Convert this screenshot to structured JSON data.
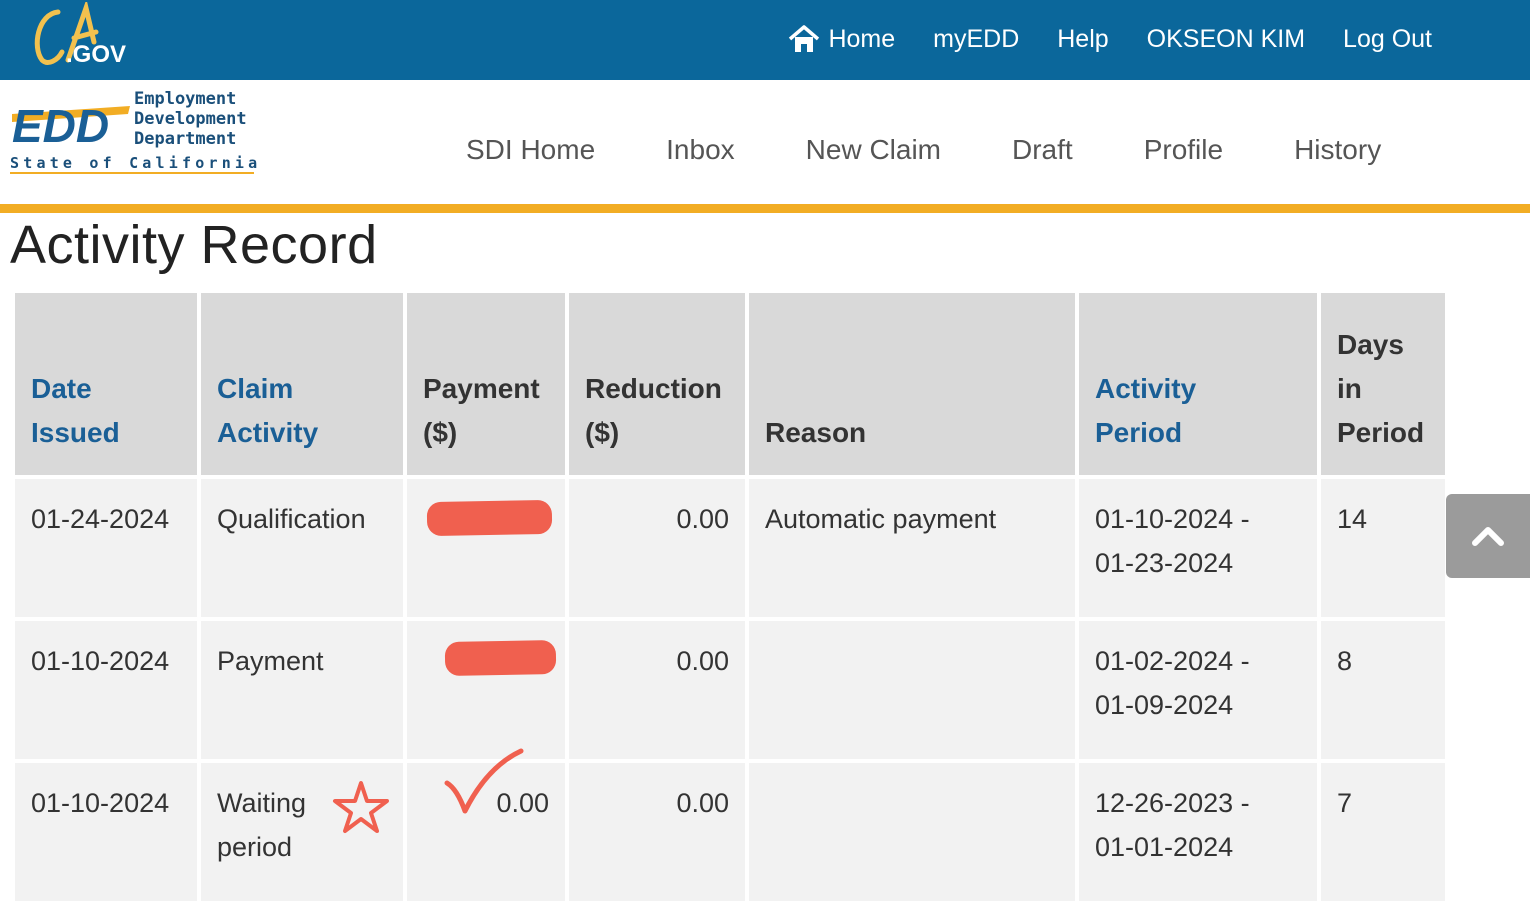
{
  "top_nav": {
    "logo_text": "CA.GOV",
    "home": "Home",
    "myedd": "myEDD",
    "help": "Help",
    "user": "OKSEON KIM",
    "logout": "Log Out"
  },
  "edd_logo": {
    "abbrev": "EDD",
    "line1": "Employment",
    "line2": "Development",
    "line3": "Department",
    "tagline": "State of California"
  },
  "sub_nav": [
    "SDI Home",
    "Inbox",
    "New Claim",
    "Draft",
    "Profile",
    "History"
  ],
  "page_title": "Activity Record",
  "table": {
    "headers": {
      "date_issued": [
        "Date",
        "Issued"
      ],
      "claim_activity": [
        "Claim",
        "Activity"
      ],
      "payment": [
        "Payment",
        "($)"
      ],
      "reduction": [
        "Reduction",
        "($)"
      ],
      "reason": "Reason",
      "activity_period": [
        "Activity",
        "Period"
      ],
      "days": [
        "Days",
        "in",
        "Period"
      ]
    },
    "rows": [
      {
        "date": "01-24-2024",
        "activity": "Qualification",
        "payment": "",
        "reduction": "0.00",
        "reason": "Automatic payment",
        "period_start": "01-10-2024 -",
        "period_end": "01-23-2024",
        "days": "14"
      },
      {
        "date": "01-10-2024",
        "activity": "Payment",
        "payment": "",
        "reduction": "0.00",
        "reason": "",
        "period_start": "01-02-2024 -",
        "period_end": "01-09-2024",
        "days": "8"
      },
      {
        "date": "01-10-2024",
        "activity": "Waiting period",
        "payment": "0.00",
        "reduction": "0.00",
        "reason": "",
        "period_start": "12-26-2023 -",
        "period_end": "01-01-2024",
        "days": "7"
      }
    ]
  },
  "colors": {
    "top_bar": "#0b679b",
    "gold_rule": "#f2ad24",
    "link_blue": "#1a5f96",
    "header_cell": "#d9d9d9",
    "body_cell": "#f2f2f2",
    "annotation_red": "#f0604f"
  },
  "icons": {
    "home": "home-icon",
    "back_to_top": "chevron-up-icon"
  }
}
